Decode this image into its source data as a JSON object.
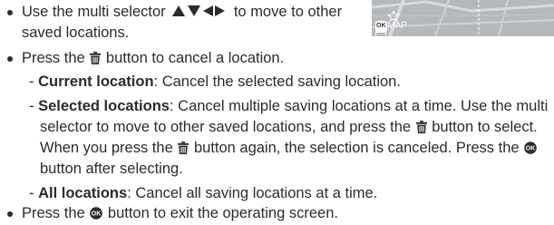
{
  "thumbnail": {
    "ok_label": "OK",
    "map_label": "MAP",
    "icons": [
      "star-icon",
      "battery-icon"
    ]
  },
  "text": {
    "b1_pre": "Use the multi selector",
    "b1_post": "to move to other",
    "b1_line2": "saved locations.",
    "b2_pre": "Press the",
    "b2_post": "button to cancel a location.",
    "d1_term": "Current location",
    "d1_text": ": Cancel the selected saving location.",
    "d2_term": "Selected locations",
    "d2_text": ": Cancel multiple saving locations at a time. Use the multi",
    "d2_line2_pre": "selector to move to other saved locations, and press the",
    "d2_line2_post": "button to select.",
    "d2_line3_pre": "When you press the",
    "d2_line3_mid": "button again, the selection is canceled. Press the",
    "d2_line4": "button after selecting.",
    "d3_term": "All locations",
    "d3_text": ": Cancel all saving locations at a time.",
    "b3_pre": "Press the",
    "b3_post": "button to exit the operating screen."
  },
  "colors": {
    "text": "#2b2b2b",
    "thumbnail_bg": "#b9bcbf"
  }
}
